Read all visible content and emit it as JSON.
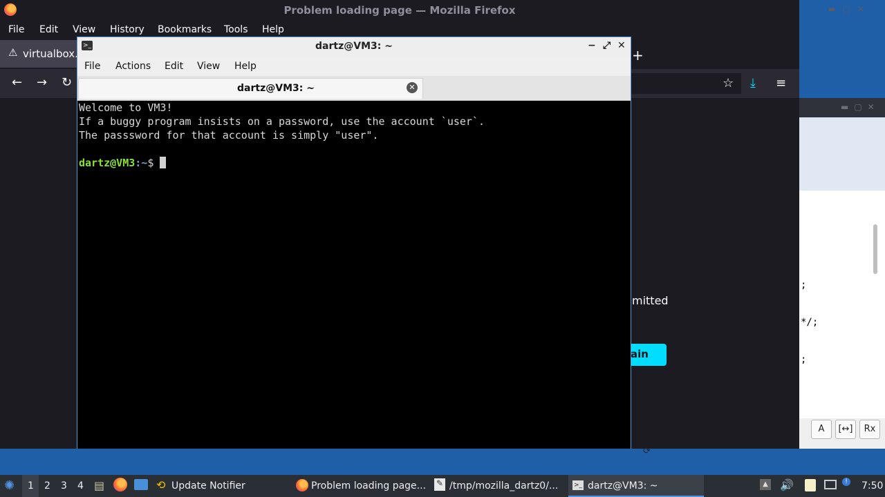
{
  "firefox": {
    "title": "Problem loading page — Mozilla Firefox",
    "menu": [
      "File",
      "Edit",
      "View",
      "History",
      "Bookmarks",
      "Tools",
      "Help"
    ],
    "tab_label": "virtualbox.o",
    "partial_text": "mitted",
    "partial_button": "ain"
  },
  "right_window": {
    "code_lines": [
      ";",
      "*/;",
      ";"
    ],
    "buttons": [
      "A",
      "[↔]",
      "Rx"
    ]
  },
  "terminal": {
    "title": "dartz@VM3: ~",
    "menu": [
      "File",
      "Actions",
      "Edit",
      "View",
      "Help"
    ],
    "tab_title": "dartz@VM3: ~",
    "output_lines": [
      "Welcome to VM3!",
      "If a buggy program insists on a password, use the account `user`.",
      "The passsword for that account is simply \"user\"."
    ],
    "prompt_user": "dartz@VM3",
    "prompt_path": ":~",
    "prompt_symbol": "$ "
  },
  "taskbar": {
    "workspaces": [
      "1",
      "2",
      "3",
      "4"
    ],
    "tasks": [
      {
        "label": "Update Notifier"
      },
      {
        "label": "Problem loading page..."
      },
      {
        "label": "/tmp/mozilla_dartz0/..."
      },
      {
        "label": "dartz@VM3: ~"
      }
    ],
    "clock": "7:50"
  },
  "colors": {
    "accent": "#5294e2",
    "firefox_button": "#00ddff",
    "prompt_user": "#8ae234",
    "prompt_path": "#729fcf"
  }
}
